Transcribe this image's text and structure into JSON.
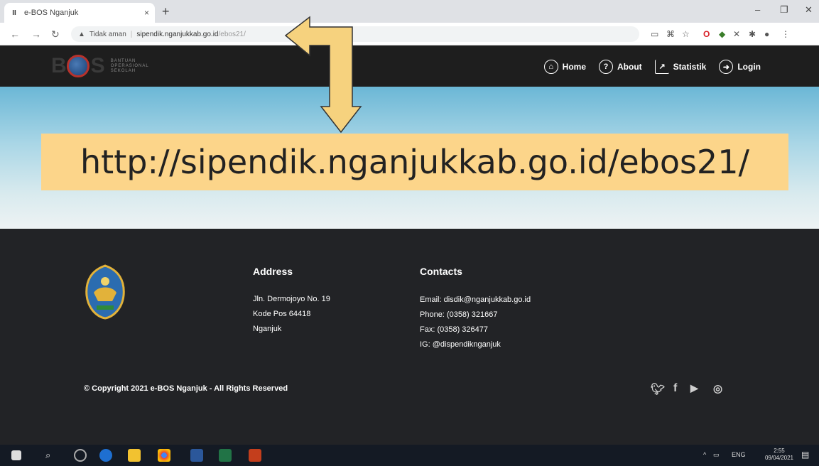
{
  "browser": {
    "tab_title": "e-BOS Nganjuk",
    "tab_favicon": "II",
    "tab_close": "×",
    "new_tab": "+",
    "security_label": "Tidak aman",
    "url_host": "sipendik.nganjukkab.go.id",
    "url_path": "/ebos21/"
  },
  "site": {
    "logo_text_1": "B",
    "logo_text_2": "S",
    "logo_sub": "BANTUAN\nOPERASIONAL\nSEKOLAH",
    "menu": [
      {
        "label": "Home",
        "icon": "home-icon"
      },
      {
        "label": "About",
        "icon": "question-icon"
      },
      {
        "label": "Statistik",
        "icon": "chart-icon"
      },
      {
        "label": "Login",
        "icon": "login-icon"
      }
    ]
  },
  "banner": {
    "url": "http://sipendik.nganjukkab.go.id/ebos21/"
  },
  "footer": {
    "address_heading": "Address",
    "address_lines": [
      "Jln. Dermojoyo No. 19",
      "Kode Pos 64418",
      "Nganjuk"
    ],
    "contacts_heading": "Contacts",
    "contact_lines": [
      "Email: disdik@nganjukkab.go.id",
      "Phone: (0358) 321667",
      "Fax: (0358) 326477",
      "IG: @dispendiknganjuk"
    ],
    "copyright": "© Copyright 2021 e-BOS Nganjuk - All Rights Reserved",
    "social": [
      "twitter-icon",
      "facebook-icon",
      "youtube-icon",
      "instagram-icon"
    ]
  },
  "taskbar": {
    "lang": "ENG",
    "time": "2:55",
    "date": "09/04/2021"
  },
  "colors": {
    "banner_bg": "#fcd58a",
    "arrow": "#f6d27e",
    "header_bg": "#1e1e1e",
    "footer_bg": "#222326"
  }
}
